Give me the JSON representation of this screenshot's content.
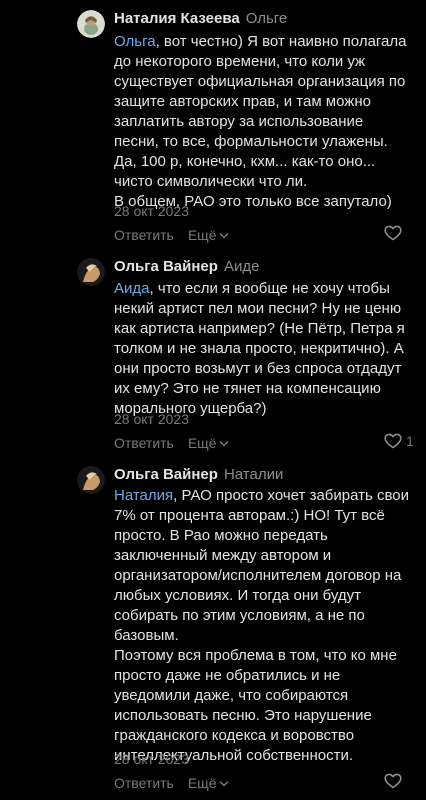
{
  "comments": [
    {
      "author": "Наталия Казеева",
      "reply_to": "Ольге",
      "mention": "Ольга",
      "lines": [
        ", вот честно) Я вот наивно полагала",
        "до некоторого времени, что коли уж",
        "существует официальная организация по",
        "защите авторских прав, и там можно",
        "заплатить автору за использование",
        "песни, то все, формальности улажены.",
        "Да, 100 р, конечно, кхм... как-то оно...",
        "чисто символически что ли.",
        "В общем, РАО это только все запутало)"
      ],
      "date": "28 окт 2023",
      "reply_label": "Ответить",
      "more_label": "Ещё",
      "likes": ""
    },
    {
      "author": "Ольга Вайнер",
      "reply_to": "Аиде",
      "mention": "Аида",
      "lines": [
        ", что если я вообще не хочу чтобы",
        "некий артист пел мои песни? Ну не ценю",
        "как артиста например? (Не Пётр, Петра я",
        "толком и не знала просто, некритично). А",
        "они просто возьмут и без спроса отдадут",
        "их ему? Это не тянет на компенсацию",
        "морального ущерба?)"
      ],
      "date": "28 окт 2023",
      "reply_label": "Ответить",
      "more_label": "Ещё",
      "likes": "1"
    },
    {
      "author": "Ольга Вайнер",
      "reply_to": "Наталии",
      "mention": "Наталия",
      "lines": [
        ", РАО просто хочет забирать свои",
        "7% от процента авторам.:) НО! Тут всё",
        "просто. В Рао можно передать",
        "заключенный между автором и",
        "организатором/исполнителем договор на",
        "любых условиях. И тогда они будут",
        "собирать по этим условиям, а не по",
        "базовым.",
        "Поэтому вся проблема в том, что ко мне",
        "просто даже не обратились и не",
        "уведомили даже, что собираются",
        "использовать песню. Это нарушение",
        "гражданского кодекса и воровство",
        "интеллектуальной собственности."
      ],
      "date": "28 окт 2023",
      "reply_label": "Ответить",
      "more_label": "Ещё",
      "likes": ""
    }
  ],
  "colors": {
    "background": "#000000",
    "text": "#e1e3e6",
    "secondary": "#76787a",
    "mention": "#71aaeb"
  },
  "icons": [
    "avatar-natalia",
    "avatar-olga",
    "chevron-down-icon",
    "heart-icon"
  ]
}
